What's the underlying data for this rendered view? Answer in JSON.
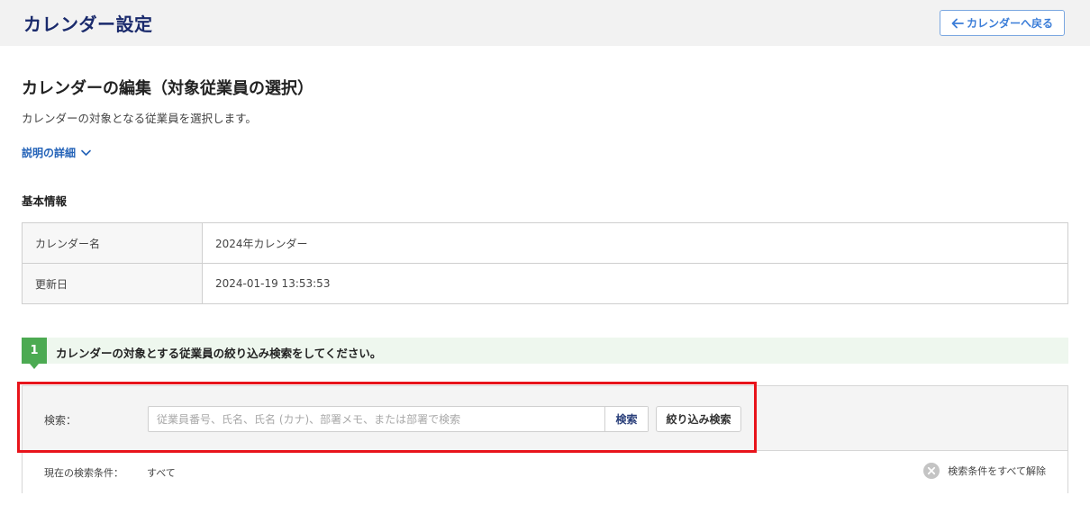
{
  "header": {
    "title": "カレンダー設定",
    "back_label": "カレンダーへ戻る"
  },
  "page": {
    "title": "カレンダーの編集（対象従業員の選択）",
    "description": "カレンダーの対象となる従業員を選択します。",
    "details_label": "説明の詳細"
  },
  "basic_info": {
    "heading": "基本情報",
    "rows": [
      {
        "label": "カレンダー名",
        "value": "2024年カレンダー"
      },
      {
        "label": "更新日",
        "value": "2024-01-19 13:53:53"
      }
    ]
  },
  "step": {
    "number": "1",
    "text": "カレンダーの対象とする従業員の絞り込み検索をしてください。"
  },
  "search": {
    "label": "検索：",
    "placeholder": "従業員番号、氏名、氏名 (カナ)、部署メモ、または部署で検索",
    "value": "",
    "submit_label": "検索",
    "filter_label": "絞り込み検索"
  },
  "conditions": {
    "label": "現在の検索条件：",
    "value": "すべて",
    "clear_label": "検索条件をすべて解除"
  },
  "colors": {
    "accent_blue": "#1a2a6c",
    "link_blue": "#2463b8",
    "step_green": "#4caa52",
    "highlight_red": "#e8141b"
  },
  "icons": {
    "back": "arrow-left-icon",
    "details": "chevron-down-icon",
    "clear": "clear-circle-icon"
  }
}
